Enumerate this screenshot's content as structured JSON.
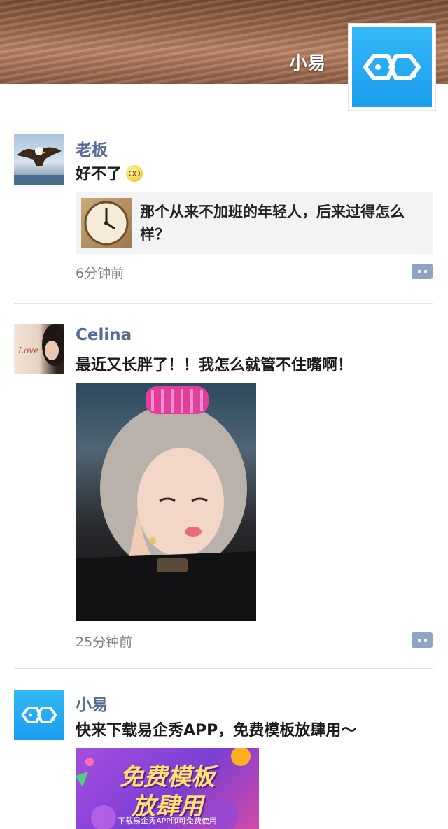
{
  "cover": {
    "name": "小易"
  },
  "posts": [
    {
      "author": "老板",
      "text": "好不了",
      "emoji_icon": "smiley-face-icon",
      "link_card": {
        "title": "那个从来不加班的年轻人，后来过得怎么样？"
      },
      "time": "6分钟前"
    },
    {
      "author": "Celina",
      "text": "最近又长胖了！！我怎么就管不住嘴啊！",
      "time": "25分钟前"
    },
    {
      "author": "小易",
      "text": "快来下载易企秀APP，免费模板放肆用～",
      "ad": {
        "line1": "免费模板",
        "line2": "放肆用",
        "sub": "下载易企秀APP即可免费使用"
      }
    }
  ],
  "colors": {
    "name_blue": "#576b95",
    "brand_blue": "#1a9ef0",
    "comment_btn": "#8fa3c2"
  }
}
